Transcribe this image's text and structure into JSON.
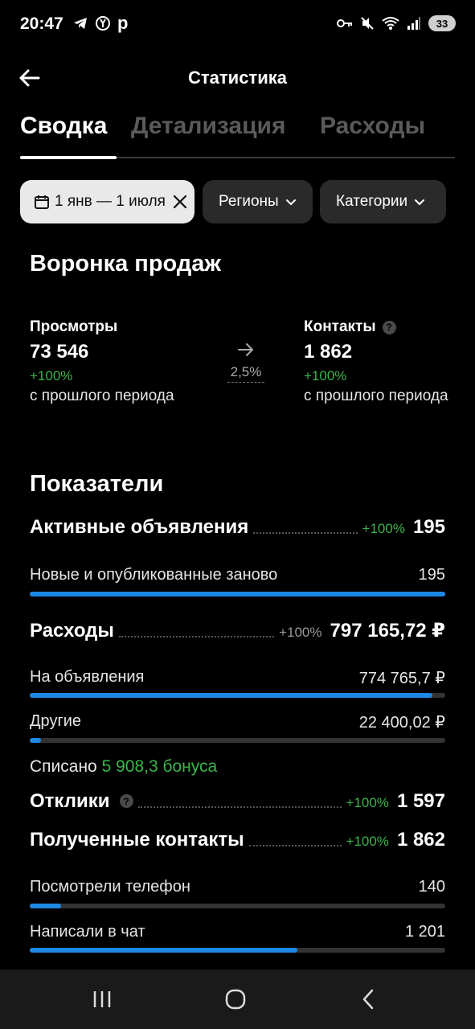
{
  "status_bar": {
    "time": "20:47",
    "left_icons": [
      "telegram-icon",
      "yandex-icon",
      "p-app-icon"
    ],
    "right_icons": [
      "key-icon",
      "mute-icon",
      "wifi-icon",
      "signal-icon"
    ],
    "battery": "33",
    "p_glyph": "p"
  },
  "header": {
    "title": "Статистика"
  },
  "tabs": [
    {
      "label": "Сводка",
      "active": true
    },
    {
      "label": "Детализация",
      "active": false
    },
    {
      "label": "Расходы",
      "active": false
    }
  ],
  "filters": {
    "date": "1 янв — 1 июля",
    "regions": "Регионы",
    "categories": "Категории"
  },
  "funnel": {
    "title": "Воронка продаж",
    "views": {
      "label": "Просмотры",
      "value": "73 546",
      "change": "+100%",
      "note": "с прошлого периода"
    },
    "conversion": "2,5%",
    "contacts": {
      "label": "Контакты",
      "value": "1 862",
      "change": "+100%",
      "note": "с прошлого периода"
    }
  },
  "metrics": {
    "title": "Показатели",
    "active_ads": {
      "label": "Активные объявления",
      "change": "+100%",
      "value": "195",
      "sub": [
        {
          "label": "Новые и опубликованные заново",
          "value": "195",
          "fraction": 1.0
        }
      ]
    },
    "expenses": {
      "label": "Расходы",
      "change": "+100%",
      "value": "797 165,72 ₽",
      "sub": [
        {
          "label": "На объявления",
          "value": "774 765,7 ₽",
          "fraction": 0.97
        },
        {
          "label": "Другие",
          "value": "22 400,02 ₽",
          "fraction": 0.028
        }
      ],
      "written_off_prefix": "Списано",
      "written_off_bonus": "5 908,3 бонуса"
    },
    "responses": {
      "label": "Отклики",
      "change": "+100%",
      "value": "1 597"
    },
    "received_contacts": {
      "label": "Полученные контакты",
      "change": "+100%",
      "value": "1 862",
      "sub": [
        {
          "label": "Посмотрели телефон",
          "value": "140",
          "fraction": 0.075
        },
        {
          "label": "Написали в чат",
          "value": "1 201",
          "fraction": 0.645
        }
      ]
    }
  },
  "colors": {
    "accent_bar": "#1e88e5",
    "positive": "#3ab54a",
    "background": "#000000"
  }
}
